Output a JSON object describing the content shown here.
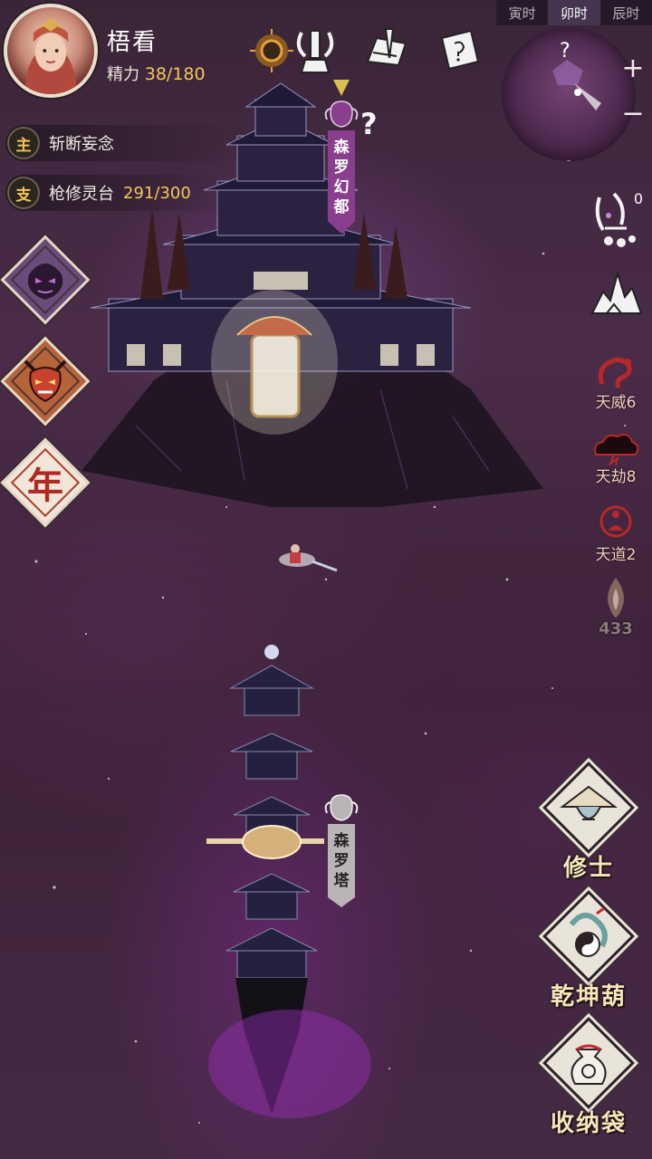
{
  "player": {
    "name": "梧看",
    "energy_label": "精力",
    "energy_value": "38/180"
  },
  "quests": [
    {
      "tag": "主",
      "text": "斩断妄念",
      "progress": ""
    },
    {
      "tag": "支",
      "text": "枪修灵台",
      "progress": "291/300"
    }
  ],
  "left_buttons": [
    {
      "icon": "demon-face-icon",
      "label": ""
    },
    {
      "icon": "oni-mask-icon",
      "label": ""
    },
    {
      "icon": "new-year-icon",
      "label": "年"
    }
  ],
  "top_icons": [
    "sun-disc-icon",
    "sword-altar-icon",
    "scroll-brush-icon",
    "map-scroll-icon"
  ],
  "time_tabs": [
    "寅时",
    "卯时",
    "辰时"
  ],
  "active_time_tab": 1,
  "minimap": {
    "marker": "?",
    "zoom_in": "+",
    "zoom_out": "−"
  },
  "right_column": [
    {
      "icon": "music-wind-chime-icon",
      "label": "",
      "badge": "0"
    },
    {
      "icon": "mountain-peaks-icon",
      "label": ""
    },
    {
      "icon": "dragon-icon",
      "label": "天威6"
    },
    {
      "icon": "storm-cloud-icon",
      "label": "天劫8"
    },
    {
      "icon": "meditating-figure-icon",
      "label": "天道2"
    },
    {
      "icon": "spirit-flame-icon",
      "label": "433"
    }
  ],
  "big_buttons": [
    {
      "icon": "cultivator-hat-icon",
      "label": "修士"
    },
    {
      "icon": "gourd-yinyang-icon",
      "label": "乾坤葫"
    },
    {
      "icon": "storage-bag-icon",
      "label": "收纳袋"
    }
  ],
  "locations": [
    {
      "name": "森罗幻都",
      "chars": [
        "森",
        "罗",
        "幻",
        "都"
      ],
      "question": "?"
    },
    {
      "name": "森罗塔",
      "chars": [
        "森",
        "罗",
        "塔"
      ]
    }
  ],
  "colors": {
    "accent_gold": "#f2c75c",
    "banner_purple": "#8a3e8e",
    "banner_grey": "#b9b4b6",
    "label_red": "#f2d2c2"
  }
}
